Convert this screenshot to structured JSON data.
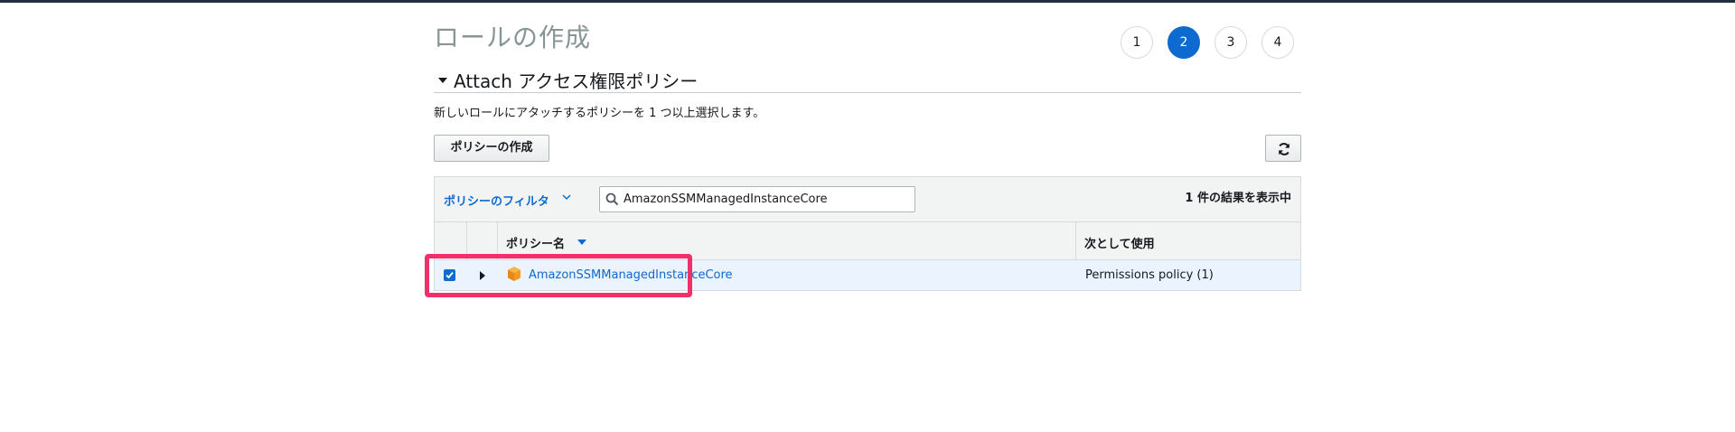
{
  "page": {
    "title": "ロールの作成"
  },
  "steps": [
    {
      "label": "1",
      "active": false
    },
    {
      "label": "2",
      "active": true
    },
    {
      "label": "3",
      "active": false
    },
    {
      "label": "4",
      "active": false
    }
  ],
  "section": {
    "title": "Attach アクセス権限ポリシー",
    "description": "新しいロールにアタッチするポリシーを 1 つ以上選択します。"
  },
  "toolbar": {
    "create_policy_label": "ポリシーの作成",
    "refresh_icon": "refresh-icon"
  },
  "filter": {
    "label": "ポリシーのフィルタ",
    "search_value": "AmazonSSMManagedInstanceCore",
    "result_count": "1 件の結果を表示中"
  },
  "table": {
    "columns": [
      "ポリシー名",
      "次として使用"
    ],
    "rows": [
      {
        "checked": true,
        "name": "AmazonSSMManagedInstanceCore",
        "usage": "Permissions policy (1)",
        "icon": "aws-managed-policy-icon"
      }
    ]
  },
  "colors": {
    "accent": "#0d6ad1",
    "highlight": "#f0306b",
    "row_selected": "#eaf3fe",
    "policy_icon": "#f49c1a"
  }
}
